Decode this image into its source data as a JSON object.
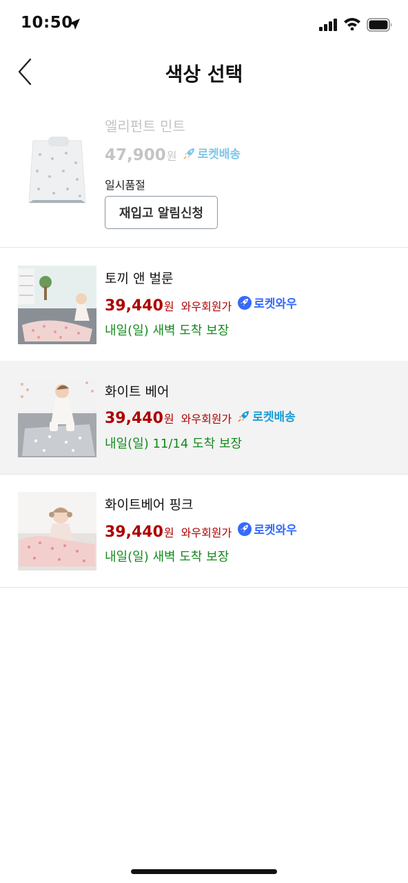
{
  "status_bar": {
    "time": "10:50",
    "icons": [
      "location-arrow-icon",
      "signal-icon",
      "wifi-icon",
      "battery-icon"
    ]
  },
  "header": {
    "title": "색상 선택",
    "back_icon": "back-chevron-icon"
  },
  "soldout_item": {
    "name": "엘리펀트 민트",
    "price": "47,900",
    "currency": "원",
    "badge": "로켓배송",
    "status": "일시품절",
    "restock_button": "재입고 알림신청"
  },
  "options": [
    {
      "name": "토끼 앤 벌룬",
      "price": "39,440",
      "currency": "원",
      "member_label": "와우회원가",
      "badge": "로켓와우",
      "delivery": "내일(일) 새벽 도착 보장"
    },
    {
      "name": "화이트 베어",
      "price": "39,440",
      "currency": "원",
      "member_label": "와우회원가",
      "badge": "로켓배송",
      "delivery": "내일(일) 11/14 도착 보장",
      "selected": true
    },
    {
      "name": "화이트베어 핑크",
      "price": "39,440",
      "currency": "원",
      "member_label": "와우회원가",
      "badge": "로켓와우",
      "delivery": "내일(일) 새벽 도착 보장"
    }
  ],
  "colors": {
    "price_red": "#ae0000",
    "delivery_green": "#138a1c",
    "rocket_wow_blue": "#346aff",
    "rocket_delivery_sky": "#1a9cd6",
    "selected_bg": "#f3f3f3"
  }
}
